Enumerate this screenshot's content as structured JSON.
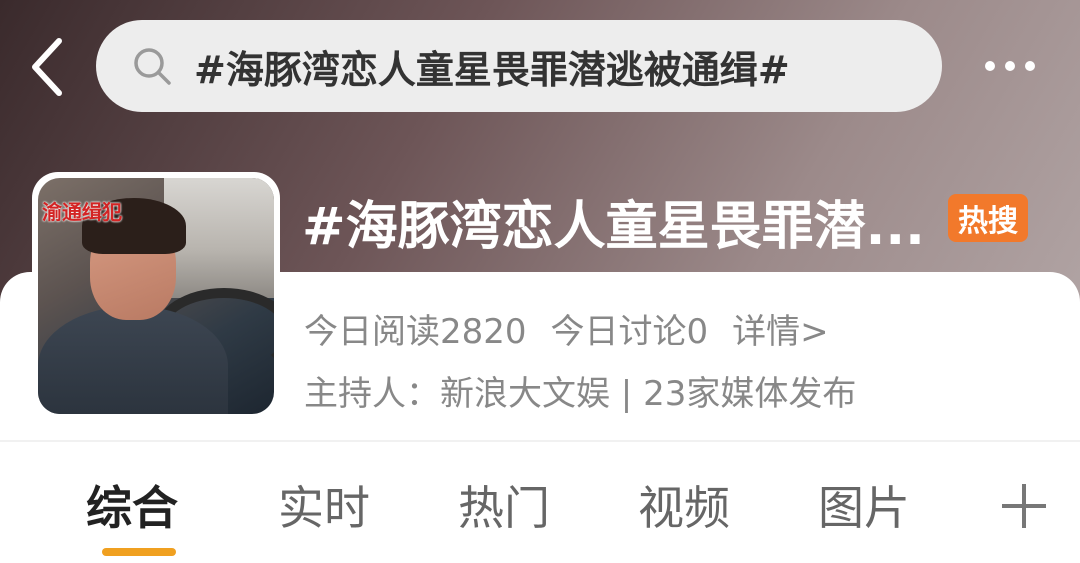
{
  "header": {
    "search_text": "#海豚湾恋人童星畏罪潜逃被通缉#"
  },
  "topic": {
    "title": "#海豚湾恋人童星畏罪潜...",
    "hot_badge": "热搜",
    "avatar_watermark": "渝通缉犯",
    "stats": {
      "read_today": "今日阅读2820",
      "discuss_today": "今日讨论0",
      "detail_link": "详情>"
    },
    "host_line": "主持人：新浪大文娱 | 23家媒体发布"
  },
  "tabs": [
    {
      "label": "综合",
      "active": true
    },
    {
      "label": "实时",
      "active": false
    },
    {
      "label": "热门",
      "active": false
    },
    {
      "label": "视频",
      "active": false
    },
    {
      "label": "图片",
      "active": false
    }
  ],
  "colors": {
    "accent_orange": "#f2792b",
    "tab_indicator": "#f0a020"
  }
}
